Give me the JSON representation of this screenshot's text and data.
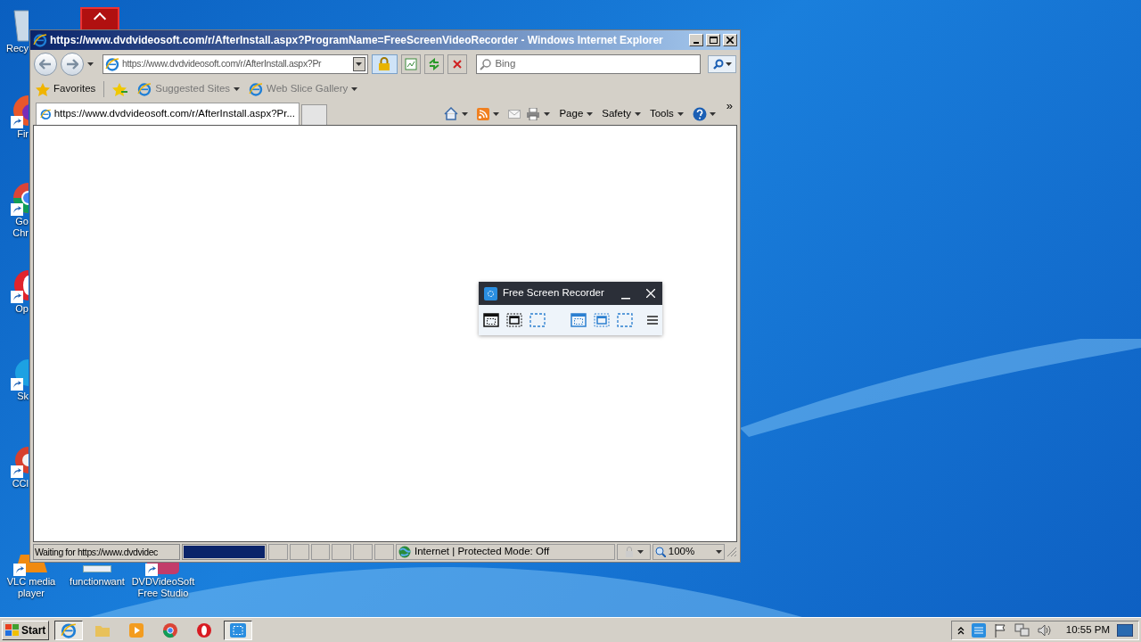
{
  "desktop_icons": [
    {
      "label": "Recy",
      "kind": "bin"
    },
    {
      "label": "Fir",
      "kind": "fox"
    },
    {
      "label": "Go\nChr",
      "kind": "chrome"
    },
    {
      "label": "Op",
      "kind": "opera"
    },
    {
      "label": "Sk",
      "kind": "skype"
    },
    {
      "label": "CCl",
      "kind": "ccleaner"
    }
  ],
  "bottom_icons": [
    {
      "label": "VLC media\nplayer",
      "kind": "vlc"
    },
    {
      "label": "functionwant",
      "kind": "doc"
    },
    {
      "label": "DVDVideoSoft\nFree Studio",
      "kind": "studio"
    }
  ],
  "browser": {
    "title": "https://www.dvdvideosoft.com/r/AfterInstall.aspx?ProgramName=FreeScreenVideoRecorder - Windows Internet Explorer",
    "address": "https://www.dvdvideosoft.com/r/AfterInstall.aspx?Pr",
    "search": {
      "placeholder": "Bing"
    },
    "favorites": "Favorites",
    "links": [
      "Suggested Sites",
      "Web Slice Gallery"
    ],
    "tabs": [
      {
        "label": "https://www.dvdvideosoft.com/r/AfterInstall.aspx?Pr...",
        "selected": true
      }
    ],
    "commands": [
      "Page",
      "Safety",
      "Tools"
    ],
    "more": "»",
    "status": {
      "text": "Waiting for https://www.dvdvidec",
      "level": 1,
      "zone": "Internet | Protected Mode: Off",
      "zoom": "100%"
    }
  },
  "recorder": {
    "title": "Free Screen Recorder"
  },
  "taskbar": {
    "start": "Start",
    "apps": [
      {
        "kind": "ie",
        "selected": true
      },
      {
        "kind": "folder",
        "selected": false
      },
      {
        "kind": "media",
        "selected": false
      },
      {
        "kind": "chrome",
        "selected": false
      },
      {
        "kind": "opera",
        "selected": false
      },
      {
        "kind": "recorder",
        "selected": true
      }
    ],
    "clock": "10:55 PM"
  }
}
